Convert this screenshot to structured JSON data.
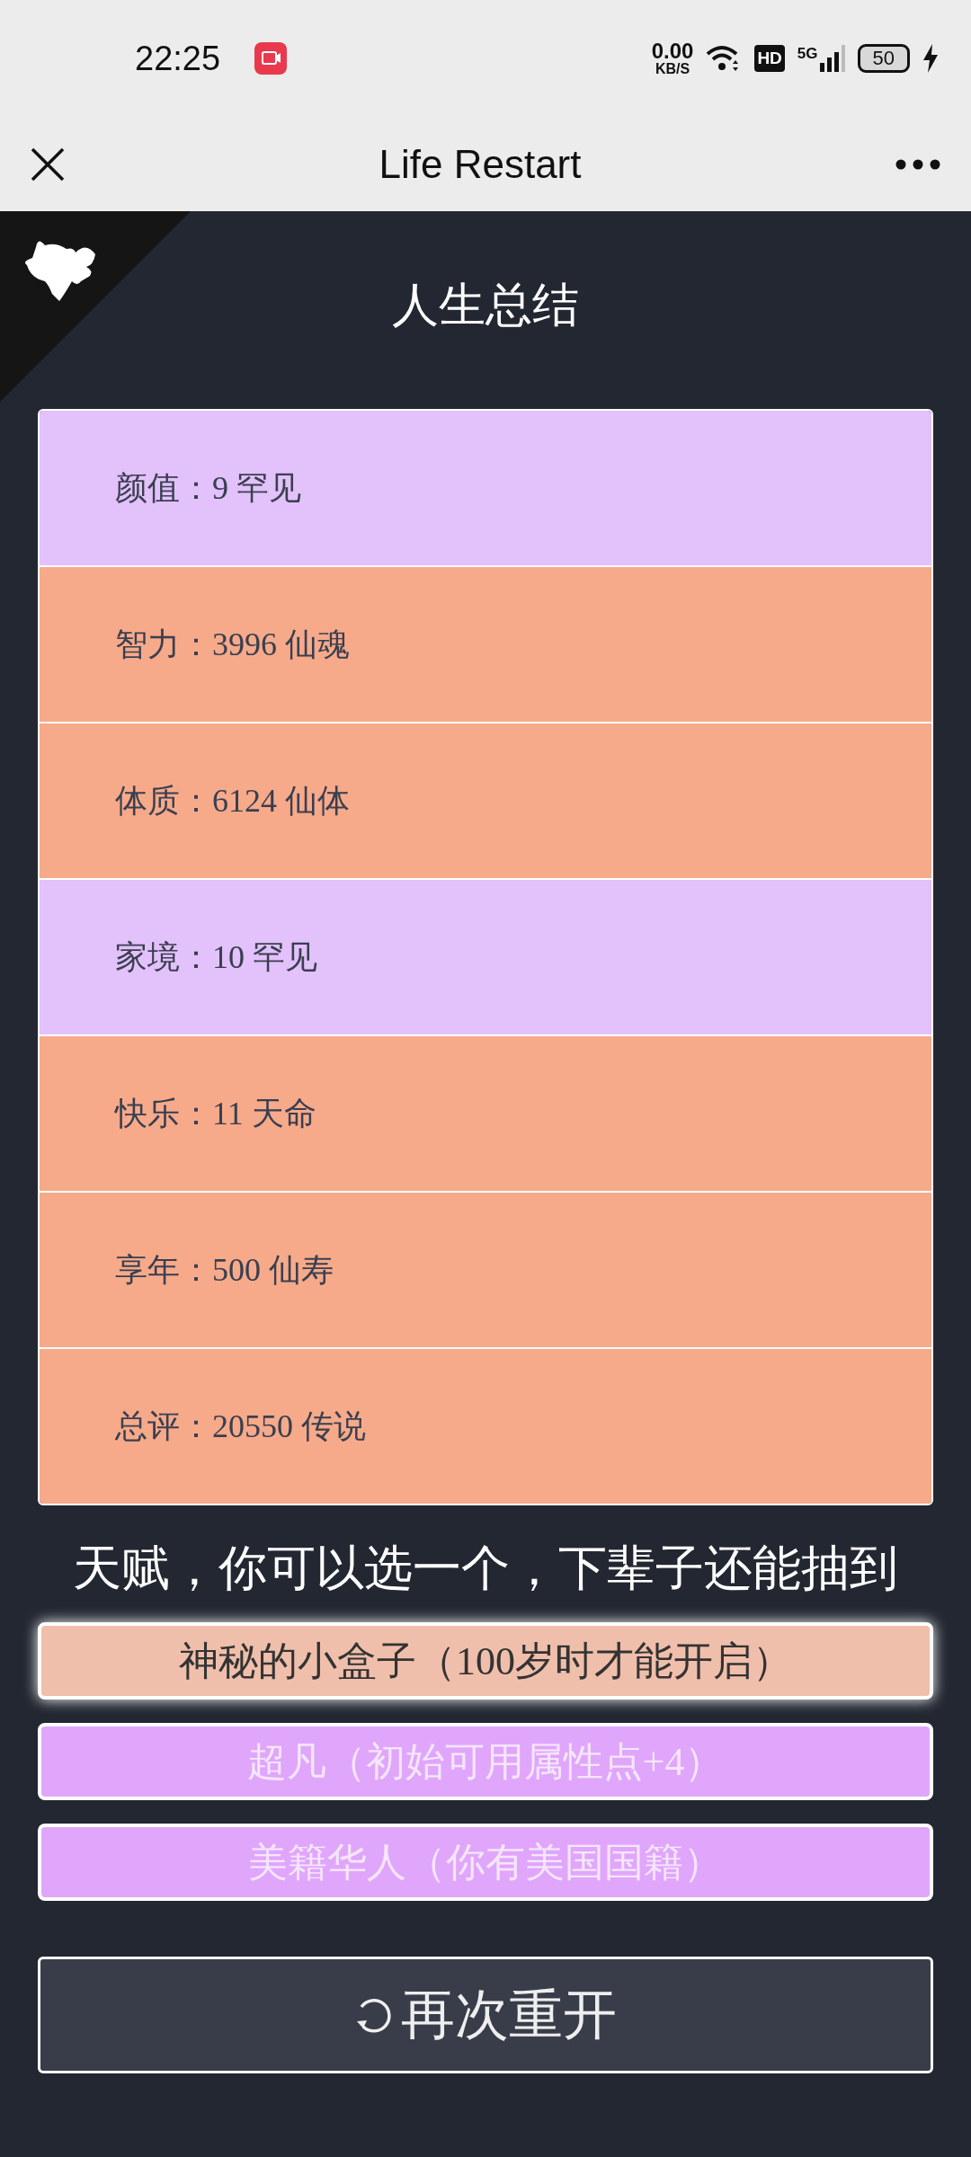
{
  "status_bar": {
    "time": "22:25",
    "net_speed": "0.00",
    "net_unit": "KB/S",
    "hd": "HD",
    "network": "5G",
    "battery": "50"
  },
  "nav": {
    "title": "Life Restart"
  },
  "title": "人生总结",
  "summary": [
    {
      "label": "颜值：9 罕见",
      "color": "#e3c1fb"
    },
    {
      "label": "智力：3996 仙魂",
      "color": "#f6aa8a"
    },
    {
      "label": "体质：6124 仙体",
      "color": "#f6aa8a"
    },
    {
      "label": "家境：10 罕见",
      "color": "#e3c1fb"
    },
    {
      "label": "快乐：11 天命",
      "color": "#f6aa8a"
    },
    {
      "label": "享年：500 仙寿",
      "color": "#f6aa8a"
    },
    {
      "label": "总评：20550 传说",
      "color": "#f6aa8a"
    }
  ],
  "talent_heading": "天赋，你可以选一个，下辈子还能抽到",
  "talents": [
    {
      "label": "神秘的小盒子（100岁时才能开启）",
      "color": "#f0bfab",
      "selected": true
    },
    {
      "label": "超凡（初始可用属性点+4）",
      "color": "#e0a6fb",
      "selected": false
    },
    {
      "label": "美籍华人（你有美国国籍）",
      "color": "#e0a6fb",
      "selected": false
    }
  ],
  "restart_button": "再次重开"
}
